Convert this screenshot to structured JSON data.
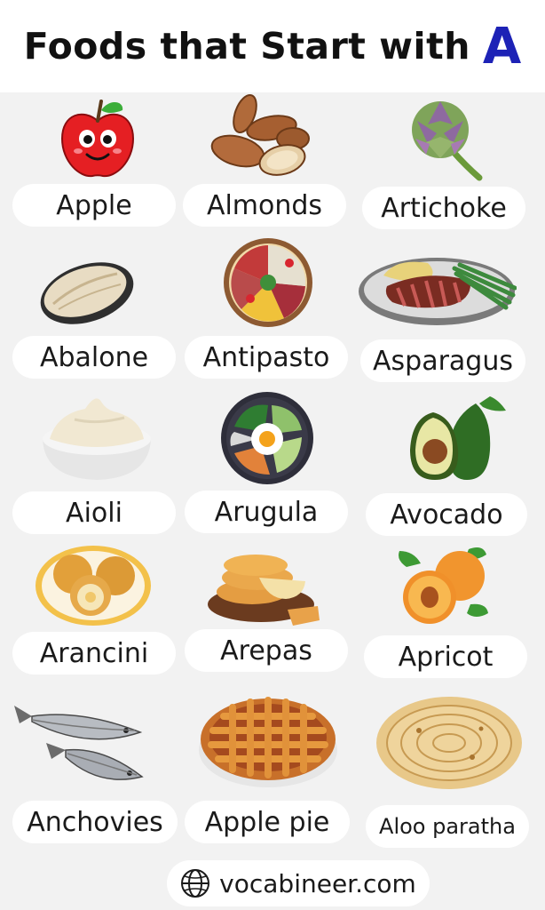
{
  "title": {
    "text": "Foods that Start with",
    "letter": "A"
  },
  "foods": [
    {
      "name": "Apple",
      "icon": "apple-icon"
    },
    {
      "name": "Almonds",
      "icon": "almonds-icon"
    },
    {
      "name": "Artichoke",
      "icon": "artichoke-icon"
    },
    {
      "name": "Abalone",
      "icon": "abalone-icon"
    },
    {
      "name": "Antipasto",
      "icon": "antipasto-icon"
    },
    {
      "name": "Asparagus",
      "icon": "asparagus-steak-icon"
    },
    {
      "name": "Aioli",
      "icon": "aioli-icon"
    },
    {
      "name": "Arugula",
      "icon": "arugula-bowl-icon"
    },
    {
      "name": "Avocado",
      "icon": "avocado-icon"
    },
    {
      "name": "Arancini",
      "icon": "arancini-icon"
    },
    {
      "name": "Arepas",
      "icon": "arepas-icon"
    },
    {
      "name": "Apricot",
      "icon": "apricot-icon"
    },
    {
      "name": "Anchovies",
      "icon": "anchovies-icon"
    },
    {
      "name": "Apple pie",
      "icon": "apple-pie-icon"
    },
    {
      "name": "Aloo paratha",
      "icon": "aloo-paratha-icon"
    }
  ],
  "footer": {
    "text": "vocabineer.com",
    "icon": "globe-icon"
  },
  "colors": {
    "accent": "#1d22b6",
    "background": "#f2f2f2",
    "card": "#ffffff"
  }
}
